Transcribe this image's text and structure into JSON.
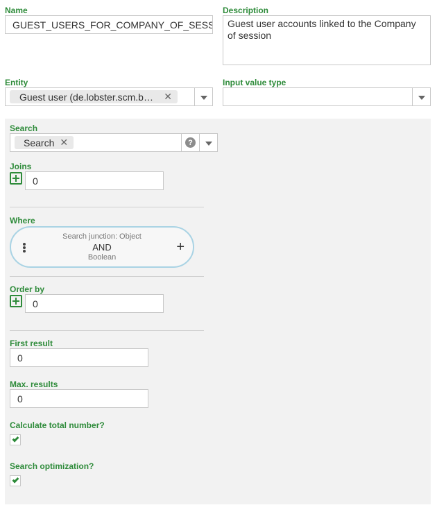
{
  "name": {
    "label": "Name",
    "value": "GUEST_USERS_FOR_COMPANY_OF_SESSION"
  },
  "description": {
    "label": "Description",
    "value": "Guest user accounts linked to the Company of session"
  },
  "entity": {
    "label": "Entity",
    "chip": "Guest user (de.lobster.scm.b…",
    "remove": "✕"
  },
  "input_value_type": {
    "label": "Input value type",
    "value": ""
  },
  "search": {
    "label": "Search",
    "chip": "Search",
    "remove": "✕",
    "help": "?"
  },
  "joins": {
    "label": "Joins",
    "value": "0"
  },
  "where": {
    "label": "Where",
    "junction_title": "Search junction: Object",
    "junction_operator": "AND",
    "junction_type": "Boolean",
    "add": "+"
  },
  "order_by": {
    "label": "Order by",
    "value": "0"
  },
  "first_result": {
    "label": "First result",
    "value": "0"
  },
  "max_results": {
    "label": "Max. results",
    "value": "0"
  },
  "calculate_total": {
    "label": "Calculate total number?",
    "checked": true
  },
  "search_optimization": {
    "label": "Search optimization?",
    "checked": true
  },
  "colors": {
    "accent_green": "#2e8b3a",
    "junction_border": "#a9d3e4",
    "panel_bg": "#f2f2f2"
  }
}
